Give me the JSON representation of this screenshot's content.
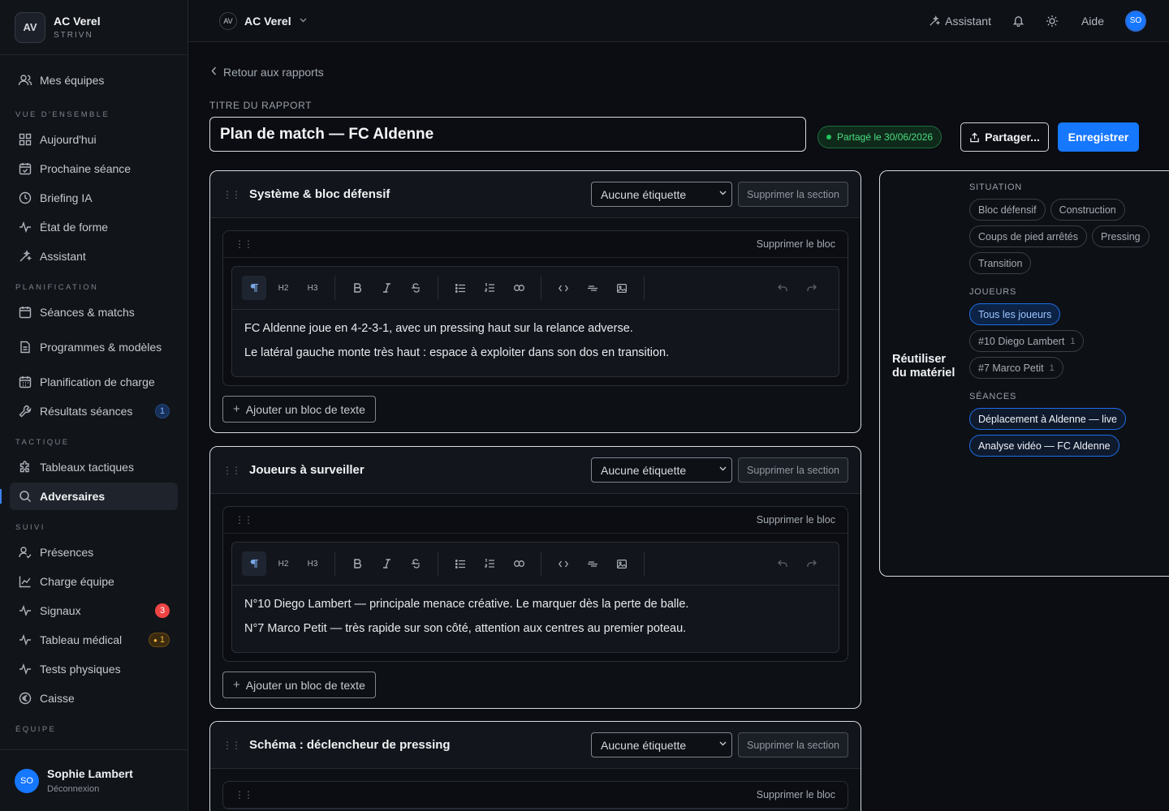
{
  "brand": {
    "initials": "AV",
    "name": "AC Verel",
    "subtitle": "STRIVN"
  },
  "sidebar": {
    "top_item": {
      "label": "Mes équipes",
      "icon": "users-icon"
    },
    "sections": [
      {
        "label": "VUE D'ENSEMBLE",
        "items": [
          {
            "label": "Aujourd'hui",
            "icon": "grid-icon"
          },
          {
            "label": "Prochaine séance",
            "icon": "calendar-check-icon"
          },
          {
            "label": "Briefing IA",
            "icon": "clock-icon"
          },
          {
            "label": "État de forme",
            "icon": "pulse-icon"
          },
          {
            "label": "Assistant",
            "icon": "sparkle-icon"
          }
        ]
      },
      {
        "label": "PLANIFICATION",
        "items": [
          {
            "label": "Séances & matchs",
            "icon": "calendar-icon"
          },
          {
            "label": "Programmes & modèles",
            "icon": "document-icon"
          },
          {
            "label": "Planification de charge",
            "icon": "calendar-grid-icon"
          },
          {
            "label": "Résultats séances",
            "icon": "wrench-icon",
            "badge": "1"
          }
        ]
      },
      {
        "label": "TACTIQUE",
        "items": [
          {
            "label": "Tableaux tactiques",
            "icon": "puzzle-icon"
          },
          {
            "label": "Adversaires",
            "icon": "search-icon",
            "active": true
          }
        ]
      },
      {
        "label": "SUIVI",
        "items": [
          {
            "label": "Présences",
            "icon": "user-check-icon"
          },
          {
            "label": "Charge équipe",
            "icon": "line-chart-icon"
          },
          {
            "label": "Signaux",
            "icon": "pulse-icon",
            "badge": "3"
          },
          {
            "label": "Tableau médical",
            "icon": "pulse-icon",
            "badge": "1"
          },
          {
            "label": "Tests physiques",
            "icon": "pulse-icon"
          },
          {
            "label": "Caisse",
            "icon": "euro-icon"
          }
        ]
      },
      {
        "label": "ÉQUIPE"
      }
    ]
  },
  "user": {
    "initials": "SO",
    "name": "Sophie Lambert",
    "logout": "Déconnexion"
  },
  "topbar": {
    "team_initials": "AV",
    "team_name": "AC Verel",
    "assistant": "Assistant",
    "help": "Aide",
    "avatar": "SO"
  },
  "page": {
    "back": "Retour aux rapports",
    "title_label": "TITRE DU RAPPORT",
    "title_value": "Plan de match — FC Aldenne",
    "shared": "Partagé le 30/06/2026",
    "share_button": "Partager...",
    "save_button": "Enregistrer"
  },
  "common": {
    "tag_placeholder": "Aucune étiquette",
    "delete_section": "Supprimer la section",
    "delete_block": "Supprimer le bloc",
    "add_block": "Ajouter un bloc de texte"
  },
  "sections": [
    {
      "title": "Système & bloc défensif",
      "lines": [
        "FC Aldenne joue en 4-2-3-1, avec un pressing haut sur la relance adverse.",
        "Le latéral gauche monte très haut : espace à exploiter dans son dos en transition."
      ]
    },
    {
      "title": "Joueurs à surveiller",
      "lines": [
        "N°10 Diego Lambert — principale menace créative. Le marquer dès la perte de balle.",
        "N°7 Marco Petit — très rapide sur son côté, attention aux centres au premier poteau."
      ]
    },
    {
      "title": "Schéma : déclencheur de pressing",
      "lines": []
    }
  ],
  "toolbar": [
    "paragraph-icon",
    "H2",
    "H3",
    "bold-icon",
    "italic-icon",
    "strike-icon",
    "bullet-list-icon",
    "numbered-list-icon",
    "link-icon",
    "code-icon",
    "divider-icon",
    "image-icon",
    "undo-icon",
    "redo-icon"
  ],
  "reuse": {
    "title": "Réutiliser du matériel",
    "situation_label": "SITUATION",
    "situations": [
      "Bloc défensif",
      "Construction",
      "Coups de pied arrêtés",
      "Pressing",
      "Transition"
    ],
    "players_label": "JOUEURS",
    "players": [
      {
        "label": "Tous les joueurs"
      },
      {
        "label": "#10 Diego Lambert",
        "count": "1"
      },
      {
        "label": "#7 Marco Petit",
        "count": "1"
      }
    ],
    "sessions_label": "SÉANCES",
    "sessions": [
      "Déplacement à Aldenne — live",
      "Analyse vidéo — FC Aldenne"
    ]
  },
  "colors": {
    "accent": "#1677ff",
    "shared_green": "#4ade80",
    "alert_red": "#ef4444",
    "warning_amber": "#f4b740"
  }
}
